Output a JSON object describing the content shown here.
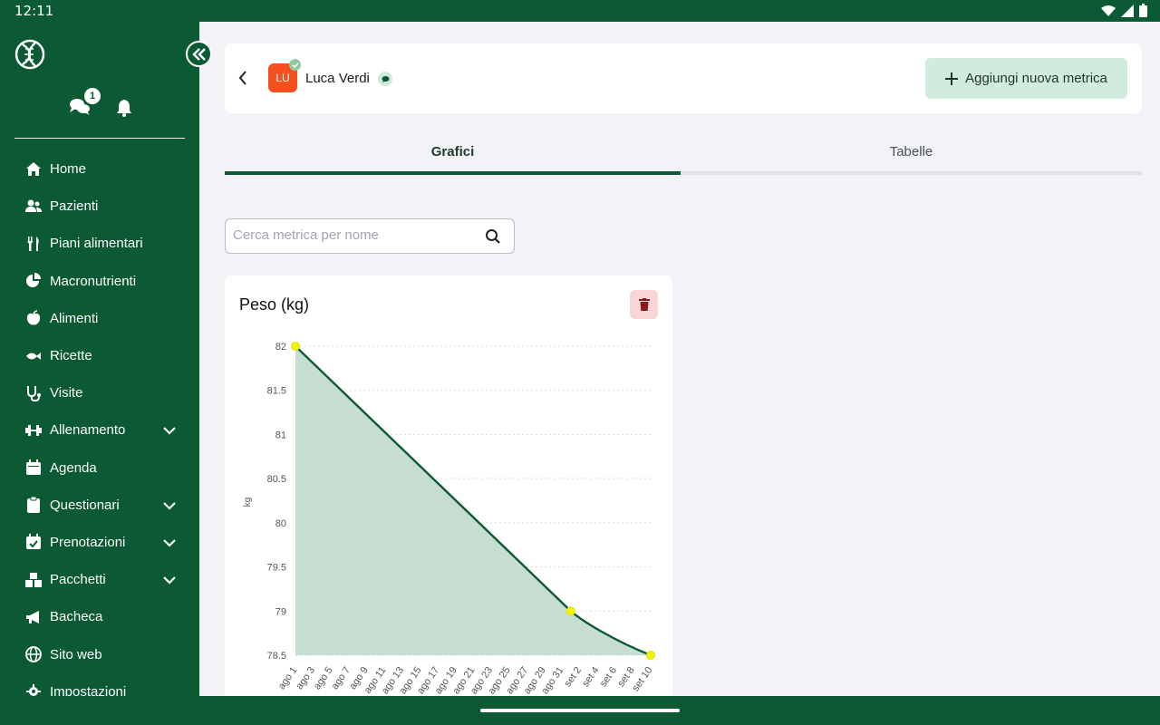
{
  "status_bar": {
    "time": "12:11"
  },
  "sidebar": {
    "chat_badge": "1",
    "items": [
      {
        "label": "Home",
        "icon": "home-icon",
        "expandable": false
      },
      {
        "label": "Pazienti",
        "icon": "users-icon",
        "expandable": false
      },
      {
        "label": "Piani alimentari",
        "icon": "utensils-icon",
        "expandable": false
      },
      {
        "label": "Macronutrienti",
        "icon": "pie-chart-icon",
        "expandable": false
      },
      {
        "label": "Alimenti",
        "icon": "apple-icon",
        "expandable": false
      },
      {
        "label": "Ricette",
        "icon": "fish-icon",
        "expandable": false
      },
      {
        "label": "Visite",
        "icon": "stethoscope-icon",
        "expandable": false
      },
      {
        "label": "Allenamento",
        "icon": "dumbbell-icon",
        "expandable": true
      },
      {
        "label": "Agenda",
        "icon": "calendar-icon",
        "expandable": false
      },
      {
        "label": "Questionari",
        "icon": "clipboard-icon",
        "expandable": true
      },
      {
        "label": "Prenotazioni",
        "icon": "calendar-check-icon",
        "expandable": true
      },
      {
        "label": "Pacchetti",
        "icon": "boxes-icon",
        "expandable": true
      },
      {
        "label": "Bacheca",
        "icon": "megaphone-icon",
        "expandable": false
      },
      {
        "label": "Sito web",
        "icon": "globe-icon",
        "expandable": false
      },
      {
        "label": "Impostazioni",
        "icon": "gear-icon",
        "expandable": false
      }
    ]
  },
  "header": {
    "avatar_initials": "LU",
    "patient_name": "Luca Verdi",
    "add_metric_label": "Aggiungi nuova metrica"
  },
  "tabs": [
    {
      "label": "Grafici",
      "active": true
    },
    {
      "label": "Tabelle",
      "active": false
    }
  ],
  "search": {
    "placeholder": "Cerca metrica per nome"
  },
  "metric_card": {
    "title": "Peso (kg)"
  },
  "colors": {
    "primary": "#0b5a34",
    "fill": "#c7ddd2",
    "point": "#f2f20a",
    "accent_light": "#d1ebdc",
    "danger_bg": "#f8d6d8",
    "danger": "#8b1a1a"
  },
  "chart_data": {
    "type": "area",
    "title": "",
    "xlabel": "",
    "ylabel": "kg",
    "ylim": [
      78.5,
      82
    ],
    "yticks": [
      "82",
      "81.5",
      "81",
      "80.5",
      "80",
      "79.5",
      "79",
      "78.5"
    ],
    "x_ticks": [
      "ago 1",
      "ago 3",
      "ago 5",
      "ago 7",
      "ago 9",
      "ago 11",
      "ago 13",
      "ago 15",
      "ago 17",
      "ago 19",
      "ago 21",
      "ago 23",
      "ago 25",
      "ago 27",
      "ago 29",
      "ago 31",
      "set 2",
      "set 4",
      "set 6",
      "set 8",
      "set 10"
    ],
    "points": [
      {
        "x": "ago 1",
        "y": 82
      },
      {
        "x": "set 1",
        "y": 79
      },
      {
        "x": "set 10",
        "y": 78.5
      }
    ],
    "grid": true
  }
}
